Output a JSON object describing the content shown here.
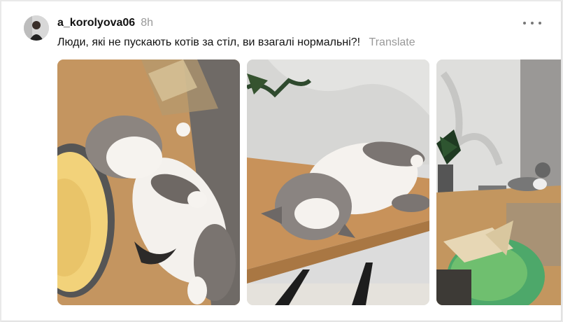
{
  "post": {
    "username": "a_korolyova06",
    "time": "8h",
    "text": "Люди, які не пускають котів за стіл, ви взагалі нормальні?!",
    "translate_label": "Translate",
    "more_icon": "more-horizontal-icon"
  },
  "photos": [
    {
      "subject": "cat-lying-on-back-beside-pancakes"
    },
    {
      "subject": "cat-lying-on-wooden-table"
    },
    {
      "subject": "cat-on-table-near-window-with-food-bowl"
    }
  ]
}
